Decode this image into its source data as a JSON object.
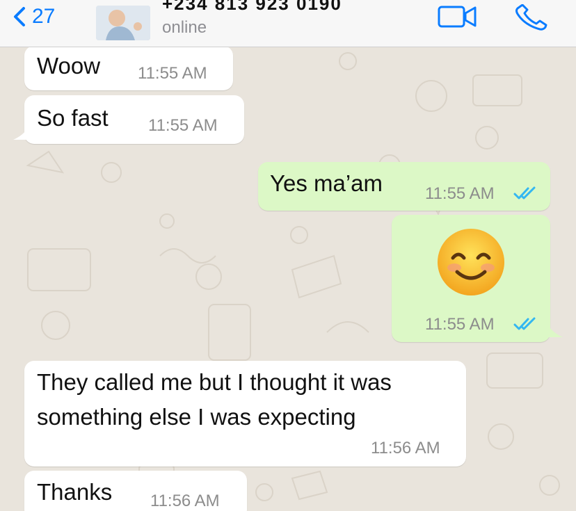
{
  "header": {
    "back_count": "27",
    "contact_name": "+234 813 923 0190",
    "status": "online"
  },
  "messages": [
    {
      "direction": "incoming",
      "text": "Woow",
      "time": "11:55 AM"
    },
    {
      "direction": "incoming",
      "text": "So fast",
      "time": "11:55 AM"
    },
    {
      "direction": "outgoing",
      "text": "Yes ma’am",
      "time": "11:55 AM",
      "read": true
    },
    {
      "direction": "outgoing",
      "emoji": "smiling-face-with-smiling-eyes",
      "time": "11:55 AM",
      "read": true
    },
    {
      "direction": "incoming",
      "text_lines": [
        "They called me but I thought it was",
        "something else I was expecting"
      ],
      "time": "11:56 AM"
    },
    {
      "direction": "incoming",
      "text": "Thanks",
      "time": "11:56 AM"
    }
  ],
  "colors": {
    "accent": "#0a7cff",
    "outgoing_bubble": "#dcf8c6",
    "incoming_bubble": "#ffffff",
    "read_ticks": "#34b7f1",
    "chat_background": "#e9e4dc"
  },
  "icons": [
    "chevron-left-icon",
    "video-call-icon",
    "phone-icon",
    "double-check-icon",
    "smiling-face-emoji"
  ]
}
